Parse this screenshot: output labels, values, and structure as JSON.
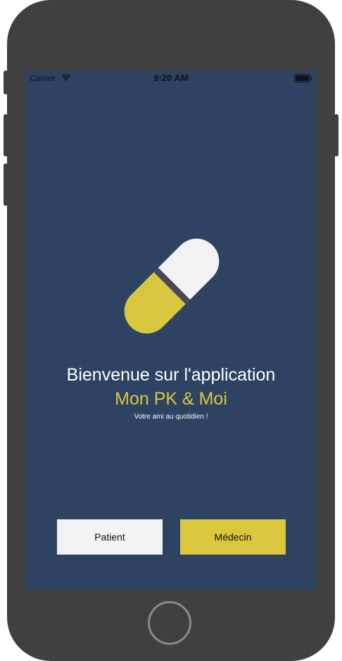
{
  "status_bar": {
    "carrier": "Carrier",
    "time": "9:20 AM",
    "wifi_icon": "wifi-icon",
    "battery_icon": "battery-icon"
  },
  "hero": {
    "icon": "pill-capsule-icon",
    "welcome": "Bienvenue sur l'application",
    "app_name": "Mon PK & Moi",
    "tagline": "Votre ami au quotidien !"
  },
  "actions": {
    "patient_label": "Patient",
    "medecin_label": "Médecin"
  },
  "colors": {
    "background": "#2e4262",
    "accent": "#dcc73e",
    "light": "#f3f3f4",
    "device": "#404040"
  }
}
